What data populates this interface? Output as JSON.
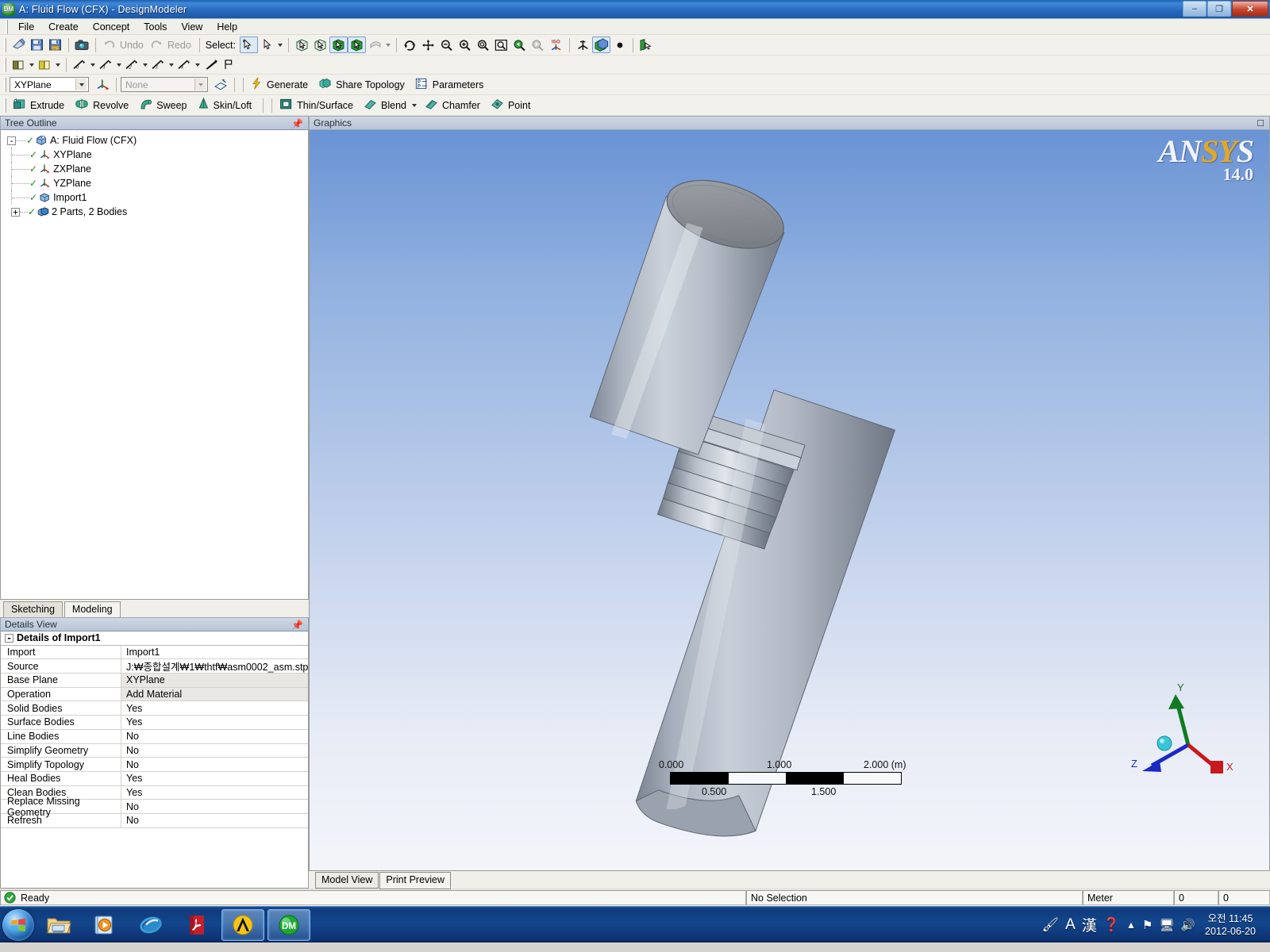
{
  "window": {
    "title": "A: Fluid Flow (CFX) - DesignModeler",
    "icon_name": "designmodeler-icon",
    "icon_text": "DM",
    "buttons": {
      "minimize": "–",
      "maximize": "❐",
      "close": "✕"
    }
  },
  "menubar": {
    "items": [
      "File",
      "Create",
      "Concept",
      "Tools",
      "View",
      "Help"
    ]
  },
  "toolbar_standard": {
    "select_label": "Select:",
    "undo_label": "Undo",
    "redo_label": "Redo",
    "icons": [
      "new-icon",
      "save-icon",
      "save-as-icon",
      "screenshot-icon",
      "undo-icon",
      "redo-icon",
      "select-single-icon",
      "select-mode-icon",
      "select-vertex-icon",
      "select-edge-icon",
      "select-face-icon",
      "select-body-icon",
      "extend-selection-icon",
      "rotate-icon",
      "pan-icon",
      "zoom-icon",
      "box-zoom-icon",
      "zoom-to-fit-icon",
      "magnify-icon",
      "previous-view-icon",
      "next-view-icon",
      "iso-view-icon",
      "look-at-icon",
      "display-model-icon",
      "display-point-icon",
      "section-plane-icon"
    ]
  },
  "toolbar_sketch": {
    "icons": [
      "display-plane-icon",
      "display-model-body-icon",
      "new-plane-0-icon",
      "new-sketch-1-icon",
      "new-sketch-2-icon",
      "new-sketch-3-icon",
      "new-sketch-x-icon",
      "plane-icon",
      "flag-icon"
    ]
  },
  "toolbar_plane": {
    "active_plane": "XYPlane",
    "new_plane_icon": "new-plane-icon",
    "active_sketch": "None",
    "new_sketch_icon": "new-sketch-icon",
    "generate_label": "Generate",
    "share_topology_label": "Share Topology",
    "parameters_label": "Parameters"
  },
  "toolbar_features": {
    "items": [
      {
        "label": "Extrude",
        "icon": "extrude-icon",
        "has_caret": false
      },
      {
        "label": "Revolve",
        "icon": "revolve-icon",
        "has_caret": false
      },
      {
        "label": "Sweep",
        "icon": "sweep-icon",
        "has_caret": false
      },
      {
        "label": "Skin/Loft",
        "icon": "skin-loft-icon",
        "has_caret": false
      },
      {
        "label": "Thin/Surface",
        "icon": "thin-surface-icon",
        "has_caret": false
      },
      {
        "label": "Blend",
        "icon": "blend-icon",
        "has_caret": true
      },
      {
        "label": "Chamfer",
        "icon": "chamfer-icon",
        "has_caret": false
      },
      {
        "label": "Point",
        "icon": "point-icon",
        "has_caret": false
      }
    ]
  },
  "tree_panel": {
    "title": "Tree Outline",
    "pin_icon": "pin-icon",
    "nodes": [
      {
        "label": "A: Fluid Flow (CFX)",
        "level": 0,
        "expander": "-",
        "icon": "project-icon",
        "checked": true
      },
      {
        "label": "XYPlane",
        "level": 1,
        "expander": "",
        "icon": "plane-icon",
        "checked": true
      },
      {
        "label": "ZXPlane",
        "level": 1,
        "expander": "",
        "icon": "plane-icon",
        "checked": true
      },
      {
        "label": "YZPlane",
        "level": 1,
        "expander": "",
        "icon": "plane-icon",
        "checked": true
      },
      {
        "label": "Import1",
        "level": 1,
        "expander": "",
        "icon": "import-icon",
        "checked": true
      },
      {
        "label": "2 Parts, 2 Bodies",
        "level": 1,
        "expander": "+",
        "icon": "bodies-icon",
        "checked": true
      }
    ]
  },
  "lower_tabs": {
    "items": [
      "Sketching",
      "Modeling"
    ],
    "active": "Modeling"
  },
  "details_panel": {
    "title": "Details View",
    "pin_icon": "pin-icon",
    "group_label": "Details of Import1",
    "group_expander": "-",
    "rows": [
      {
        "key": "Import",
        "value": "Import1",
        "shaded": false
      },
      {
        "key": "Source",
        "value": "J:₩종합설계₩1₩thtf₩asm0002_asm.stp",
        "shaded": false
      },
      {
        "key": "Base Plane",
        "value": "XYPlane",
        "shaded": true
      },
      {
        "key": "Operation",
        "value": "Add Material",
        "shaded": true
      },
      {
        "key": "Solid Bodies",
        "value": "Yes",
        "shaded": false
      },
      {
        "key": "Surface Bodies",
        "value": "Yes",
        "shaded": false
      },
      {
        "key": "Line Bodies",
        "value": "No",
        "shaded": false
      },
      {
        "key": "Simplify Geometry",
        "value": "No",
        "shaded": false
      },
      {
        "key": "Simplify Topology",
        "value": "No",
        "shaded": false
      },
      {
        "key": "Heal Bodies",
        "value": "Yes",
        "shaded": false
      },
      {
        "key": "Clean Bodies",
        "value": "Yes",
        "shaded": false
      },
      {
        "key": "Replace Missing Geometry",
        "value": "No",
        "shaded": false
      },
      {
        "key": "Refresh",
        "value": "No",
        "shaded": false
      }
    ]
  },
  "graphics": {
    "title": "Graphics",
    "restore_icon": "restore-icon",
    "logo_an": "AN",
    "logo_sy": "SY",
    "logo_s": "S",
    "version": "14.0",
    "scalebar": {
      "labels_top": [
        "0.000",
        "1.000",
        "2.000 (m)"
      ],
      "labels_bottom": [
        "0.500",
        "1.500"
      ],
      "segments": [
        "dark",
        "light",
        "dark",
        "light"
      ]
    },
    "triad": {
      "y_label": "Y",
      "x_label": "X",
      "z_label": "Z",
      "x_color": "#c8191e",
      "y_color": "#127a21",
      "z_color": "#1a28c4",
      "origin_color": "#37c6d8"
    },
    "model": {
      "name": "imported-shaft-body",
      "body_color": "#aab4c2",
      "top_face_color": "#8e9298"
    }
  },
  "view_tabs": {
    "items": [
      "Model View",
      "Print Preview"
    ],
    "active": "Print Preview"
  },
  "statusbar": {
    "status_icon": "ready-icon",
    "status": "Ready",
    "selection": "No Selection",
    "unit": "Meter",
    "value1": "0",
    "value2": "0"
  },
  "taskbar": {
    "start_icon": "windows-start-icon",
    "apps": [
      {
        "name": "explorer-taskbar-icon",
        "active": false
      },
      {
        "name": "media-player-taskbar-icon",
        "active": false
      },
      {
        "name": "internet-explorer-icon",
        "active": false
      },
      {
        "name": "acrobat-reader-icon",
        "active": false
      },
      {
        "name": "ansys-workbench-icon",
        "active": true
      },
      {
        "name": "designmodeler-taskbar-icon",
        "active": true
      }
    ],
    "tray": {
      "ime_lang": "A",
      "ime_mode": "漢",
      "help_icon": "help-icon",
      "show_hidden_icon": "show-hidden-icon",
      "network-icon": "network-icon",
      "monitor_icon": "monitor-icon",
      "volume_icon": "volume-icon"
    },
    "clock": {
      "time": "오전 11:45",
      "date": "2012-06-20"
    }
  }
}
